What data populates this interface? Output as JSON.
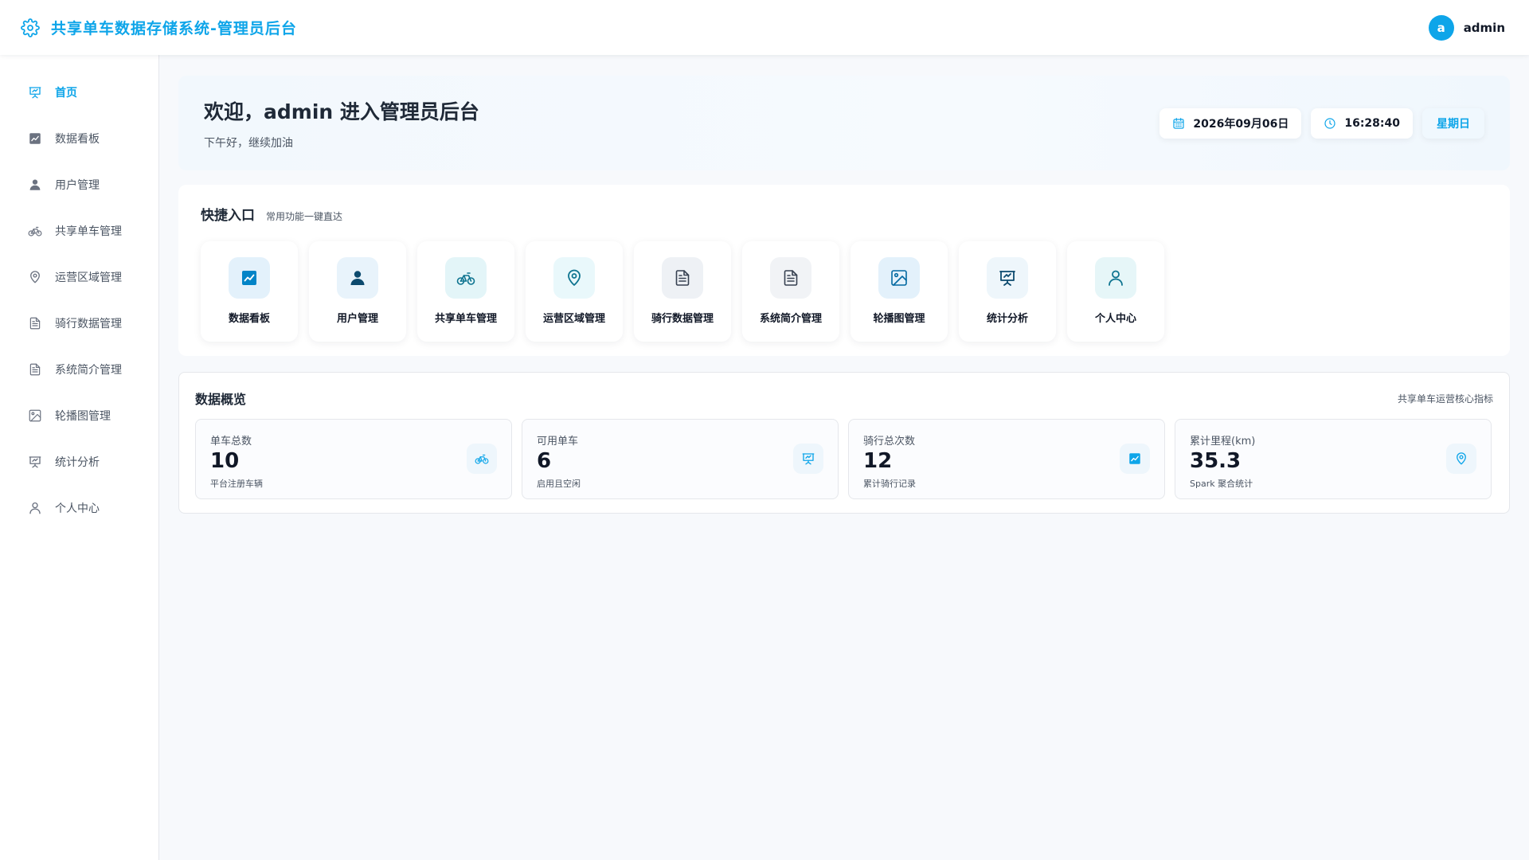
{
  "header": {
    "title": "共享单车数据存储系统-管理员后台",
    "icon": "gear-icon",
    "avatar_letter": "a",
    "username": "admin"
  },
  "sidebar": {
    "items": [
      {
        "label": "首页",
        "icon": "presentation-icon",
        "active": true
      },
      {
        "label": "数据看板",
        "icon": "chart-icon"
      },
      {
        "label": "用户管理",
        "icon": "user-icon"
      },
      {
        "label": "共享单车管理",
        "icon": "bike-icon"
      },
      {
        "label": "运营区域管理",
        "icon": "map-pin-icon"
      },
      {
        "label": "骑行数据管理",
        "icon": "document-icon"
      },
      {
        "label": "系统简介管理",
        "icon": "document-icon"
      },
      {
        "label": "轮播图管理",
        "icon": "image-icon"
      },
      {
        "label": "统计分析",
        "icon": "presentation-icon"
      },
      {
        "label": "个人中心",
        "icon": "user-outline-icon"
      }
    ]
  },
  "welcome": {
    "title": "欢迎，admin 进入管理员后台",
    "subtitle": "下午好，继续加油",
    "date": "2026年09月06日",
    "time": "16:28:40",
    "weekday": "星期日"
  },
  "quick": {
    "title": "快捷入口",
    "subtitle": "常用功能一键直达",
    "items": [
      {
        "label": "数据看板",
        "icon": "chart-icon"
      },
      {
        "label": "用户管理",
        "icon": "user-icon"
      },
      {
        "label": "共享单车管理",
        "icon": "bike-icon"
      },
      {
        "label": "运营区域管理",
        "icon": "map-pin-icon"
      },
      {
        "label": "骑行数据管理",
        "icon": "document-icon"
      },
      {
        "label": "系统简介管理",
        "icon": "document-icon"
      },
      {
        "label": "轮播图管理",
        "icon": "image-icon"
      },
      {
        "label": "统计分析",
        "icon": "presentation-icon"
      },
      {
        "label": "个人中心",
        "icon": "user-outline-icon"
      }
    ]
  },
  "overview": {
    "title": "数据概览",
    "subtitle": "共享单车运营核心指标",
    "stats": [
      {
        "label": "单车总数",
        "value": "10",
        "note": "平台注册车辆",
        "icon": "bike-icon"
      },
      {
        "label": "可用单车",
        "value": "6",
        "note": "启用且空闲",
        "icon": "presentation-icon"
      },
      {
        "label": "骑行总次数",
        "value": "12",
        "note": "累计骑行记录",
        "icon": "chart-icon"
      },
      {
        "label": "累计里程(km)",
        "value": "35.3",
        "note": "Spark 聚合统计",
        "icon": "map-pin-icon"
      }
    ]
  },
  "colors": {
    "accent": "#0ea5e9",
    "background": "#f7f9fc",
    "text": "#1f2937"
  }
}
